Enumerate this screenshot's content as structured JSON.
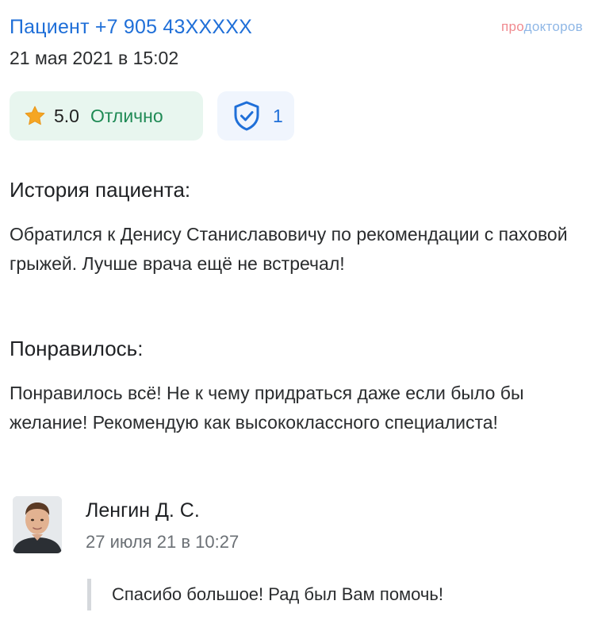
{
  "review": {
    "patient_name": "Пациент +7 905 43XXXXX",
    "date": "21 мая 2021 в 15:02",
    "brand": {
      "part1": "про",
      "part2": "докторов"
    },
    "rating": {
      "value": "5.0",
      "label": "Отлично",
      "star_color": "#f5a623"
    },
    "verified": {
      "count": "1",
      "icon": "shield-check-icon"
    },
    "sections": [
      {
        "title": "История пациента:",
        "text": "Обратился к Денису Станиславовичу по рекомендации с паховой грыжей. Лучше врача ещё не встречал!"
      },
      {
        "title": "Понравилось:",
        "text": "Понравилось всё! Не к чему придраться даже если было бы желание! Рекомендую как высококлассного специалиста!"
      }
    ],
    "reply": {
      "author": "Ленгин Д. С.",
      "date": "27 июля 21 в 10:27",
      "text": "Спасибо большое! Рад был Вам помочь!"
    }
  },
  "colors": {
    "accent_blue": "#1f6fd8",
    "rating_green": "#1f8a55",
    "rating_bg": "#e8f6ef",
    "verified_bg": "#f0f5fd"
  }
}
